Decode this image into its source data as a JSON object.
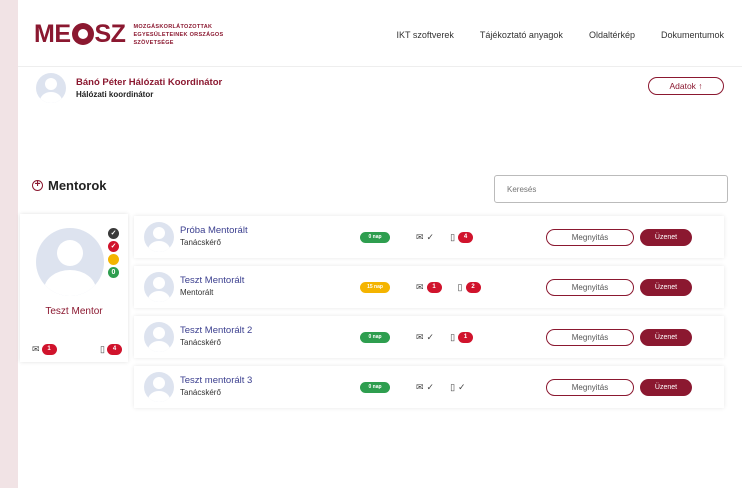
{
  "brand": {
    "logo_text": "MEOSZ",
    "subtitle": "MOZGÁSKORLÁTOZOTTAK EGYESÜLETEINEK ORSZÁGOS SZÖVETSÉGE"
  },
  "nav": [
    "IKT szoftverek",
    "Tájékoztató anyagok",
    "Oldaltérkép",
    "Dokumentumok"
  ],
  "user": {
    "name": "Bánó Péter Hálózati Koordinátor",
    "role": "Hálózati koordinátor",
    "adatok_label": "Adatok ↑"
  },
  "section": {
    "title": "Mentorok",
    "search_placeholder": "Keresés"
  },
  "mentor": {
    "name": "Teszt Mentor",
    "message_count": "1",
    "task_count": "4",
    "status_colors": [
      "#3a3a3a",
      "#d0132c",
      "#f4b400",
      "#2e9e4f"
    ]
  },
  "colors": {
    "brand": "#8b1830",
    "badge": "#d0132c",
    "pill_green": "#2e9e4f",
    "pill_yellow": "#f4b400",
    "link": "#3b3f8f"
  },
  "rows": [
    {
      "name": "Próba Mentorált",
      "role": "Tanácskérő",
      "pill": "0 nap",
      "pill_color": "#2e9e4f",
      "msg_badge": "",
      "task_badge": "4"
    },
    {
      "name": "Teszt Mentorált",
      "role": "Mentorált",
      "pill": "15 nap",
      "pill_color": "#f4b400",
      "msg_badge": "1",
      "task_badge": "2"
    },
    {
      "name": "Teszt Mentorált 2",
      "role": "Tanácskérő",
      "pill": "0 nap",
      "pill_color": "#2e9e4f",
      "msg_badge": "",
      "task_badge": "1"
    },
    {
      "name": "Teszt mentorált 3",
      "role": "Tanácskérő",
      "pill": "0 nap",
      "pill_color": "#2e9e4f",
      "msg_badge": "",
      "task_badge": ""
    }
  ],
  "buttons": {
    "open_label": "Megnyitás",
    "message_label": "Üzenet"
  }
}
